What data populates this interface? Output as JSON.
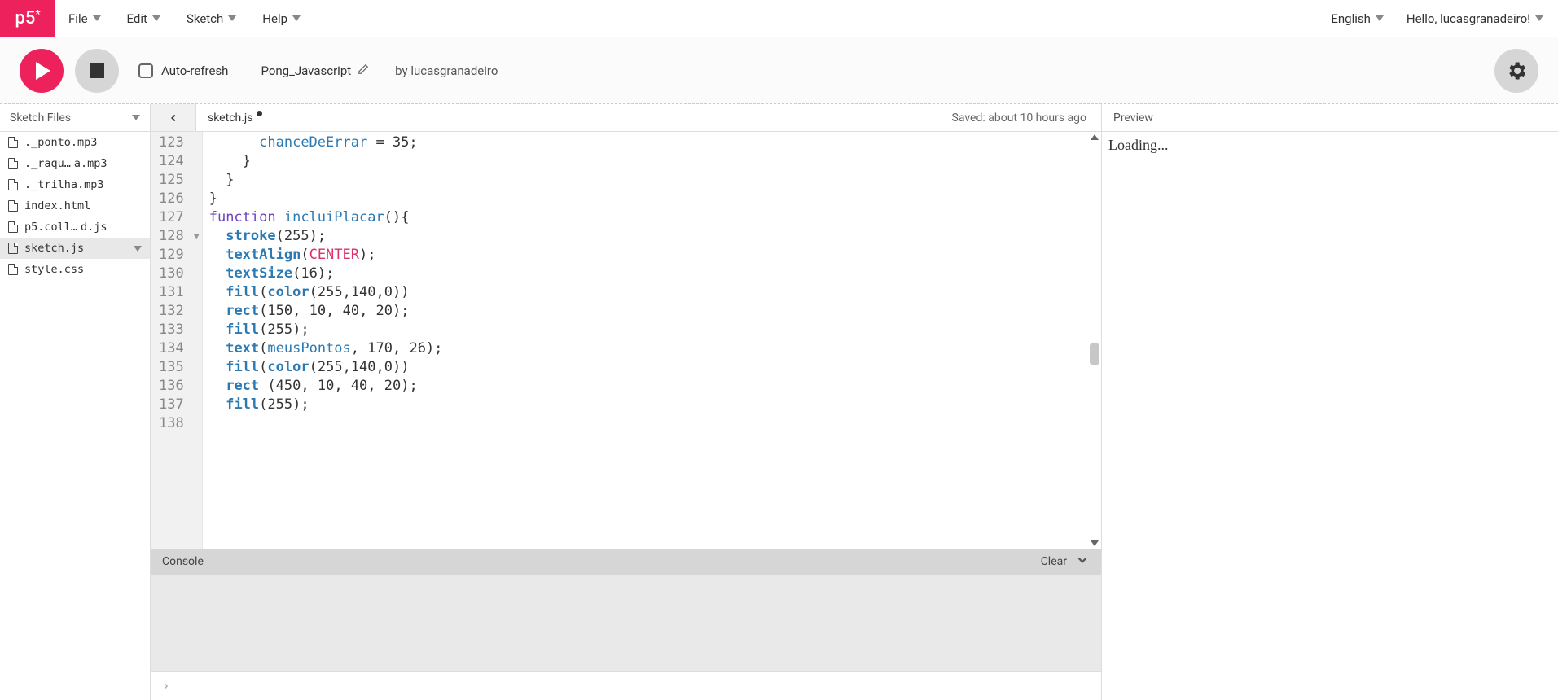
{
  "logo": "p5",
  "menu": {
    "file": "File",
    "edit": "Edit",
    "sketch": "Sketch",
    "help": "Help"
  },
  "lang": "English",
  "greeting": "Hello, lucasgranadeiro!",
  "toolbar": {
    "auto_refresh": "Auto-refresh",
    "sketch_name": "Pong_Javascript",
    "by_prefix": "by",
    "author": "lucasgranadeiro"
  },
  "sidebar": {
    "title": "Sketch Files",
    "files": [
      {
        "a": "._ponto.mp3",
        "b": "",
        "selected": false
      },
      {
        "a": "._raqu…",
        "b": "a.mp3",
        "selected": false
      },
      {
        "a": "._trilha.mp3",
        "b": "",
        "selected": false
      },
      {
        "a": "index.html",
        "b": "",
        "selected": false
      },
      {
        "a": "p5.coll…",
        "b": "d.js",
        "selected": false
      },
      {
        "a": "sketch.js",
        "b": "",
        "selected": true
      },
      {
        "a": "style.css",
        "b": "",
        "selected": false
      }
    ]
  },
  "editor": {
    "tab": "sketch.js",
    "dirty": true,
    "saved": "Saved: about 10 hours ago",
    "first_line": 123,
    "fold_line": 128,
    "lines": [
      [
        [
          "      "
        ],
        [
          "chanceDeErrar",
          "id"
        ],
        [
          " = "
        ],
        [
          "35",
          "num"
        ],
        [
          ";"
        ]
      ],
      [
        [
          "    }"
        ]
      ],
      [
        [
          "  }"
        ]
      ],
      [
        [
          "}"
        ]
      ],
      [
        [
          ""
        ]
      ],
      [
        [
          "function ",
          "kw"
        ],
        [
          "incluiPlacar",
          "id"
        ],
        [
          "(){"
        ]
      ],
      [
        [
          "  "
        ],
        [
          "stroke",
          "fn"
        ],
        [
          "("
        ],
        [
          "255",
          "num"
        ],
        [
          ");"
        ]
      ],
      [
        [
          "  "
        ],
        [
          "textAlign",
          "fn"
        ],
        [
          "("
        ],
        [
          "CENTER",
          "const"
        ],
        [
          ");"
        ]
      ],
      [
        [
          "  "
        ],
        [
          "textSize",
          "fn"
        ],
        [
          "("
        ],
        [
          "16",
          "num"
        ],
        [
          ");"
        ]
      ],
      [
        [
          "  "
        ],
        [
          "fill",
          "fn"
        ],
        [
          "("
        ],
        [
          "color",
          "fn"
        ],
        [
          "("
        ],
        [
          "255",
          "num"
        ],
        [
          ","
        ],
        [
          "140",
          "num"
        ],
        [
          ","
        ],
        [
          "0",
          "num"
        ],
        [
          "))"
        ]
      ],
      [
        [
          "  "
        ],
        [
          "rect",
          "fn"
        ],
        [
          "("
        ],
        [
          "150",
          "num"
        ],
        [
          ", "
        ],
        [
          "10",
          "num"
        ],
        [
          ", "
        ],
        [
          "40",
          "num"
        ],
        [
          ", "
        ],
        [
          "20",
          "num"
        ],
        [
          ");"
        ]
      ],
      [
        [
          "  "
        ],
        [
          "fill",
          "fn"
        ],
        [
          "("
        ],
        [
          "255",
          "num"
        ],
        [
          ");"
        ]
      ],
      [
        [
          "  "
        ],
        [
          "text",
          "fn"
        ],
        [
          "("
        ],
        [
          "meusPontos",
          "id"
        ],
        [
          ", "
        ],
        [
          "170",
          "num"
        ],
        [
          ", "
        ],
        [
          "26",
          "num"
        ],
        [
          ");"
        ]
      ],
      [
        [
          "  "
        ],
        [
          "fill",
          "fn"
        ],
        [
          "("
        ],
        [
          "color",
          "fn"
        ],
        [
          "("
        ],
        [
          "255",
          "num"
        ],
        [
          ","
        ],
        [
          "140",
          "num"
        ],
        [
          ","
        ],
        [
          "0",
          "num"
        ],
        [
          "))"
        ]
      ],
      [
        [
          "  "
        ],
        [
          "rect",
          "fn"
        ],
        [
          " ("
        ],
        [
          "450",
          "num"
        ],
        [
          ", "
        ],
        [
          "10",
          "num"
        ],
        [
          ", "
        ],
        [
          "40",
          "num"
        ],
        [
          ", "
        ],
        [
          "20",
          "num"
        ],
        [
          ");"
        ]
      ],
      [
        [
          "  "
        ],
        [
          "fill",
          "fn"
        ],
        [
          "("
        ],
        [
          "255",
          "num"
        ],
        [
          ");"
        ]
      ]
    ]
  },
  "console": {
    "title": "Console",
    "clear": "Clear"
  },
  "preview": {
    "title": "Preview",
    "content": "Loading..."
  }
}
